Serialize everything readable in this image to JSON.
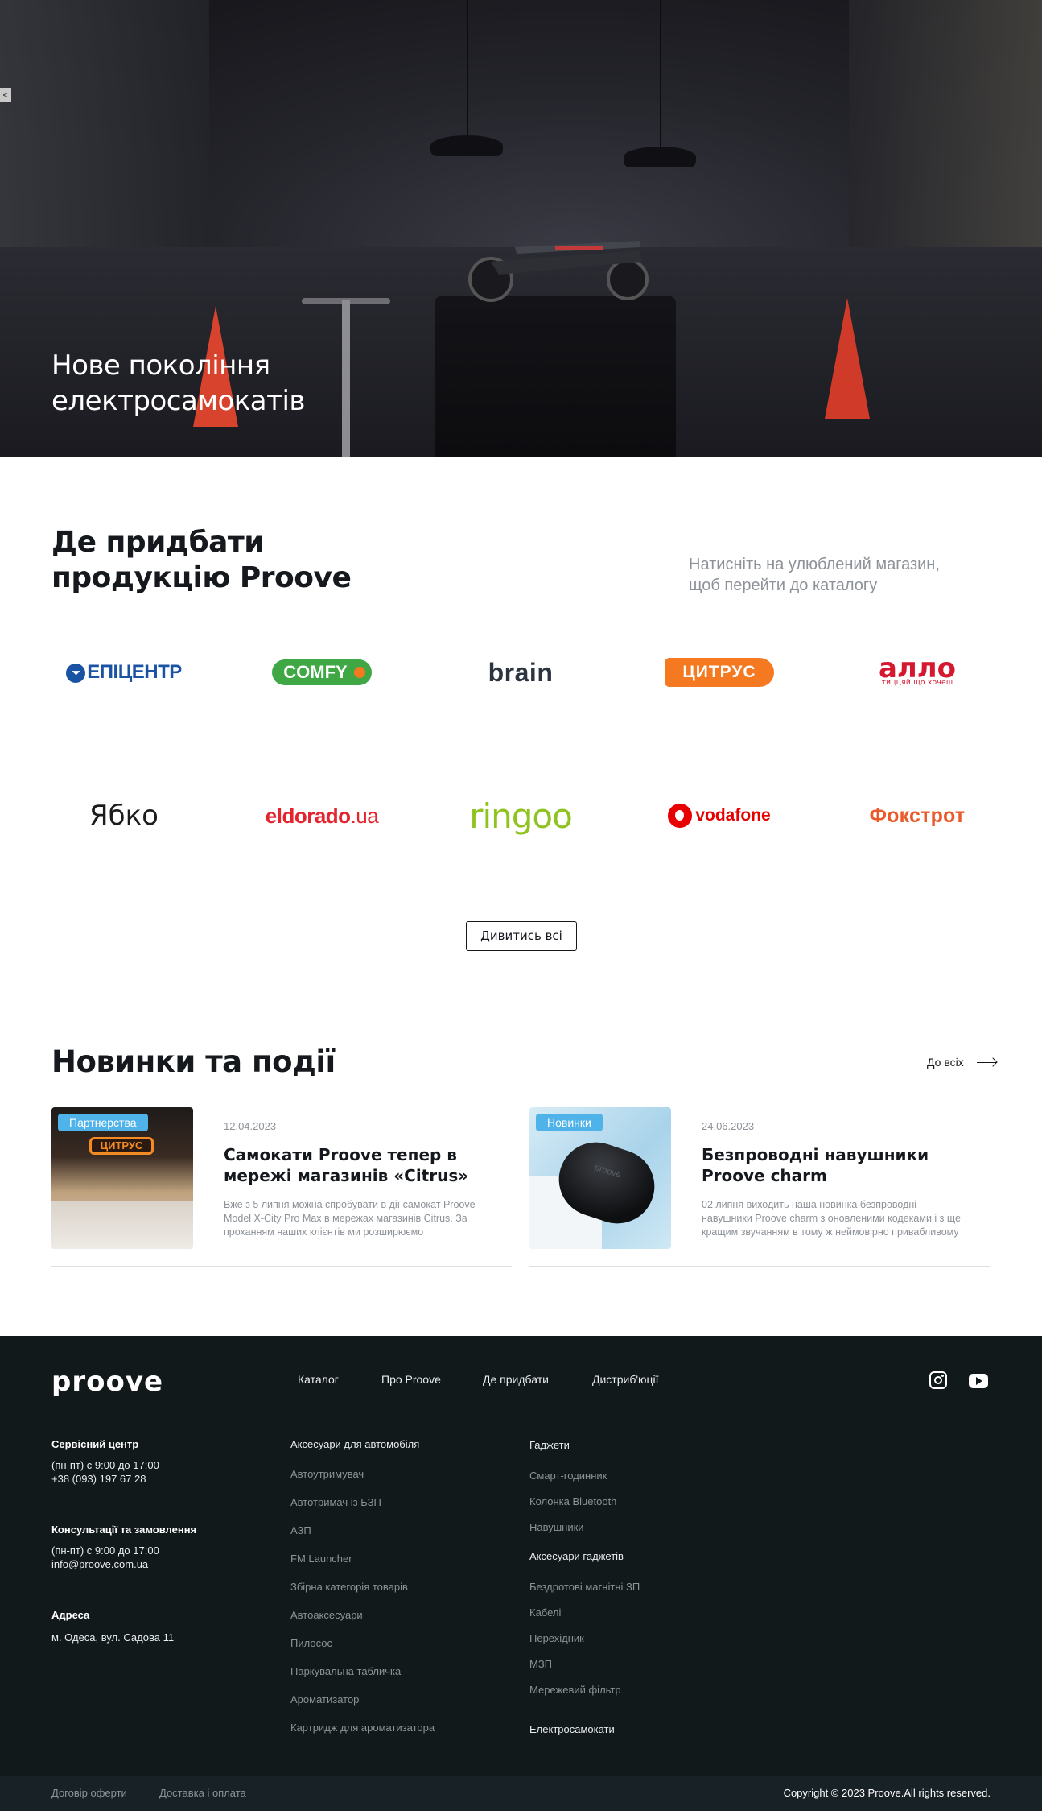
{
  "hero": {
    "title_line1": "Нове покоління",
    "title_line2": "електросамокатів",
    "side_tab": "<"
  },
  "where_to_buy": {
    "title_line1": "Де придбати",
    "title_line2": "продукцію Proove",
    "hint_line1": "Натисніть на улюблений магазин,",
    "hint_line2": "щоб перейти до каталогу",
    "stores": [
      {
        "name": "ЕПІЦЕНТР",
        "icon": "epicentr-logo",
        "color": "#1b53a4"
      },
      {
        "name": "COMFY",
        "icon": "comfy-logo",
        "color": "#3fa844"
      },
      {
        "name": "brain",
        "icon": "brain-logo",
        "color": "#2b3540"
      },
      {
        "name": "ЦИТРУС",
        "icon": "citrus-logo",
        "color": "#f47920"
      },
      {
        "name": "алло",
        "tagline": "тиццяй що хочеш",
        "icon": "allo-logo",
        "color": "#d5172f"
      },
      {
        "name": "Ябко",
        "icon": "yabko-logo",
        "color": "#1c1c1c"
      },
      {
        "name": "eldorado",
        "suffix": ".ua",
        "icon": "eldorado-logo",
        "color": "#e4242f"
      },
      {
        "name": "ringoo",
        "icon": "ringoo-logo",
        "color": "#8fc31f"
      },
      {
        "name": "vodafone",
        "icon": "vodafone-logo",
        "color": "#e60000"
      },
      {
        "name": "Фокстрот",
        "icon": "foxtrot-logo",
        "color": "#ea5a2a"
      }
    ],
    "see_all_label": "Дивитись всі"
  },
  "news": {
    "title": "Новинки та події",
    "all_label": "До всіх",
    "items": [
      {
        "tag": "Партнерства",
        "date": "12.04.2023",
        "headline": "Самокати Proove тепер в мережі магазинів «Citrus»",
        "excerpt": "Вже з 5 липня можна спробувати в дії самокат Proove Model X-City Pro Max в мережах магазинів Citrus. За проханням наших клієнтів ми розширюємо",
        "image_sign": "ЦИТРУС"
      },
      {
        "tag": "Новинки",
        "date": "24.06.2023",
        "headline": "Безпроводні навушники Proove charm",
        "excerpt": "02 липня виходить наша новинка безпроводні навушники Proove charm з оновленими кодеками і з ще кращим звучанням в тому ж неймовірно привабливому",
        "image_sign": "proove"
      }
    ]
  },
  "footer": {
    "brand": "proove",
    "nav": [
      "Каталог",
      "Про Proove",
      "Де придбати",
      "Дистриб'юції"
    ],
    "social": [
      "instagram-icon",
      "youtube-icon"
    ],
    "contacts": [
      {
        "title": "Сервісний центр",
        "lines": [
          "(пн-пт) с 9:00 до 17:00",
          "+38 (093) 197 67 28"
        ]
      },
      {
        "title": "Консультації та замовлення",
        "lines": [
          "(пн-пт) с 9:00 до 17:00",
          "info@proove.com.ua"
        ]
      },
      {
        "title": "Адреса",
        "lines": [
          "м. Одеса, вул. Садова 11"
        ]
      }
    ],
    "car_accessories": {
      "title": "Аксесуари для автомобіля",
      "items": [
        "Автоутримувач",
        "Автотримач із БЗП",
        "АЗП",
        "FM Launcher",
        "Збірна категорія товарів",
        "Автоаксесуари",
        "Пилосос",
        "Паркувальна табличка",
        "Ароматизатор",
        "Картридж для ароматизатора"
      ]
    },
    "gadgets": {
      "title": "Гаджети",
      "items": [
        "Смарт-годинник",
        "Колонка Bluetooth",
        "Навушники"
      ]
    },
    "gadget_accessories": {
      "title": "Аксесуари гаджетів",
      "items": [
        "Бездротові магнітні ЗП",
        "Кабелі",
        "Перехідник",
        "МЗП",
        "Мережевий фільтр"
      ]
    },
    "scooters": "Електросамокати",
    "bottom_links": [
      "Договір оферти",
      "Доставка і оплата"
    ],
    "copyright": "Copyright © 2023 Proove.All rights reserved."
  }
}
